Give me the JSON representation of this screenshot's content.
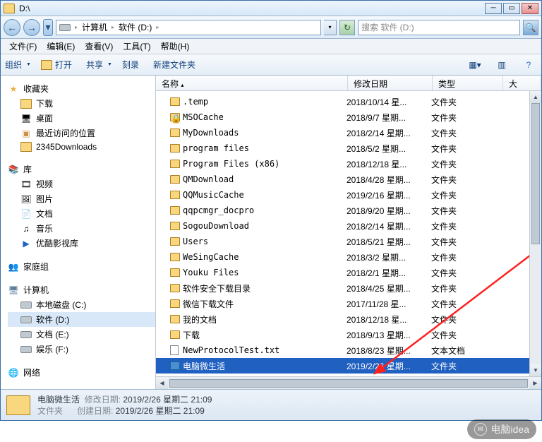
{
  "title": "D:\\",
  "nav": {
    "back": "←",
    "fwd": "→"
  },
  "breadcrumb": {
    "root": "计算机",
    "current": "软件 (D:)"
  },
  "search": {
    "placeholder": "搜索 软件 (D:)"
  },
  "menu": {
    "file": "文件(F)",
    "edit": "编辑(E)",
    "view": "查看(V)",
    "tools": "工具(T)",
    "help": "帮助(H)"
  },
  "toolbar": {
    "organize": "组织",
    "open": "打开",
    "share": "共享",
    "burn": "刻录",
    "newfolder": "新建文件夹"
  },
  "sidebar": {
    "fav": "收藏夹",
    "fav_items": [
      "下载",
      "桌面",
      "最近访问的位置",
      "2345Downloads"
    ],
    "lib": "库",
    "lib_items": [
      "视频",
      "图片",
      "文档",
      "音乐",
      "优酷影视库"
    ],
    "home": "家庭组",
    "comp": "计算机",
    "comp_items": [
      "本地磁盘 (C:)",
      "软件 (D:)",
      "文档 (E:)",
      "娱乐 (F:)"
    ],
    "net": "网络"
  },
  "columns": {
    "name": "名称",
    "date": "修改日期",
    "type": "类型",
    "size": "大"
  },
  "files": [
    {
      "name": ".temp",
      "date": "2018/10/14 星...",
      "type": "文件夹",
      "kind": "folder"
    },
    {
      "name": "MSOCache",
      "date": "2018/9/7 星期...",
      "type": "文件夹",
      "kind": "folder-lock"
    },
    {
      "name": "MyDownloads",
      "date": "2018/2/14 星期...",
      "type": "文件夹",
      "kind": "folder"
    },
    {
      "name": "program files",
      "date": "2018/5/2 星期...",
      "type": "文件夹",
      "kind": "folder"
    },
    {
      "name": "Program Files (x86)",
      "date": "2018/12/18 星...",
      "type": "文件夹",
      "kind": "folder"
    },
    {
      "name": "QMDownload",
      "date": "2018/4/28 星期...",
      "type": "文件夹",
      "kind": "folder"
    },
    {
      "name": "QQMusicCache",
      "date": "2019/2/16 星期...",
      "type": "文件夹",
      "kind": "folder"
    },
    {
      "name": "qqpcmgr_docpro",
      "date": "2018/9/20 星期...",
      "type": "文件夹",
      "kind": "folder"
    },
    {
      "name": "SogouDownload",
      "date": "2018/2/14 星期...",
      "type": "文件夹",
      "kind": "folder"
    },
    {
      "name": "Users",
      "date": "2018/5/21 星期...",
      "type": "文件夹",
      "kind": "folder"
    },
    {
      "name": "WeSingCache",
      "date": "2018/3/2 星期...",
      "type": "文件夹",
      "kind": "folder"
    },
    {
      "name": "Youku Files",
      "date": "2018/2/1 星期...",
      "type": "文件夹",
      "kind": "folder"
    },
    {
      "name": "软件安全下载目录",
      "date": "2018/4/25 星期...",
      "type": "文件夹",
      "kind": "folder"
    },
    {
      "name": "微信下载文件",
      "date": "2017/11/28 星...",
      "type": "文件夹",
      "kind": "folder"
    },
    {
      "name": "我的文档",
      "date": "2018/12/18 星...",
      "type": "文件夹",
      "kind": "folder"
    },
    {
      "name": "下载",
      "date": "2018/9/13 星期...",
      "type": "文件夹",
      "kind": "folder-dl"
    },
    {
      "name": "NewProtocolTest.txt",
      "date": "2018/8/23 星期...",
      "type": "文本文档",
      "kind": "file"
    },
    {
      "name": "电脑微生活",
      "date": "2019/2/26 星期...",
      "type": "文件夹",
      "kind": "folder-sel",
      "selected": true
    }
  ],
  "status": {
    "name": "电脑微生活",
    "label_mod": "修改日期:",
    "mod": "2019/2/26 星期二 21:09",
    "type_label": "文件夹",
    "label_create": "创建日期:",
    "create": "2019/2/26 星期二 21:09"
  },
  "watermark": "电脑idea"
}
